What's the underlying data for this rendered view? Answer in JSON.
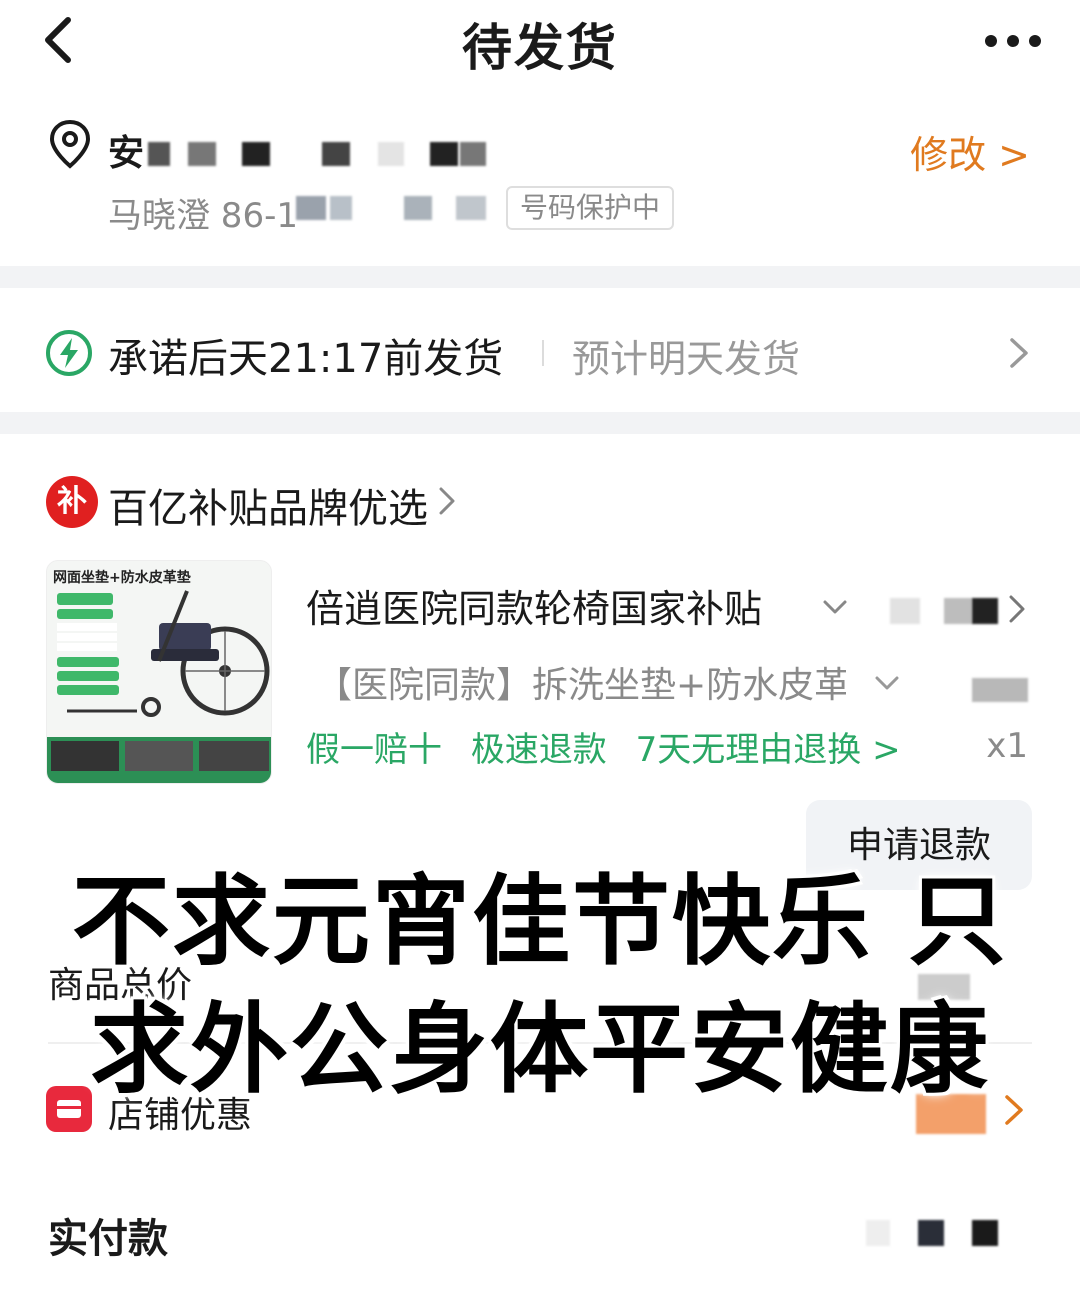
{
  "header": {
    "title": "待发货"
  },
  "address": {
    "first_char": "安",
    "name_phone": "马晓澄 86-1",
    "privacy_badge": "号码保护中",
    "modify_label": "修改 >"
  },
  "shipping": {
    "promise": "承诺后天21:17前发货",
    "estimate": "预计明天发货"
  },
  "store": {
    "name": "百亿补贴品牌优选",
    "badge_char": "补"
  },
  "product": {
    "image_caption": "网面坐垫+防水皮革垫",
    "title": "倍逍医院同款轮椅国家补贴",
    "spec": "【医院同款】拆洗坐垫+防水皮革",
    "guarantees": [
      "假一赔十",
      "极速退款",
      "7天无理由退换 >"
    ],
    "quantity": "x1",
    "refund_button": "申请退款"
  },
  "summary": {
    "total_label": "商品总价",
    "discount_label": "店铺优惠",
    "paid_label": "实付款"
  },
  "overlay": {
    "line1": "不求元宵佳节快乐 只",
    "line2": "求外公身体平安健康"
  },
  "colors": {
    "accent_orange": "#e07a1f",
    "guarantee_green": "#2aa765",
    "subsidy_red": "#e02020",
    "shop_red": "#e8293d"
  }
}
